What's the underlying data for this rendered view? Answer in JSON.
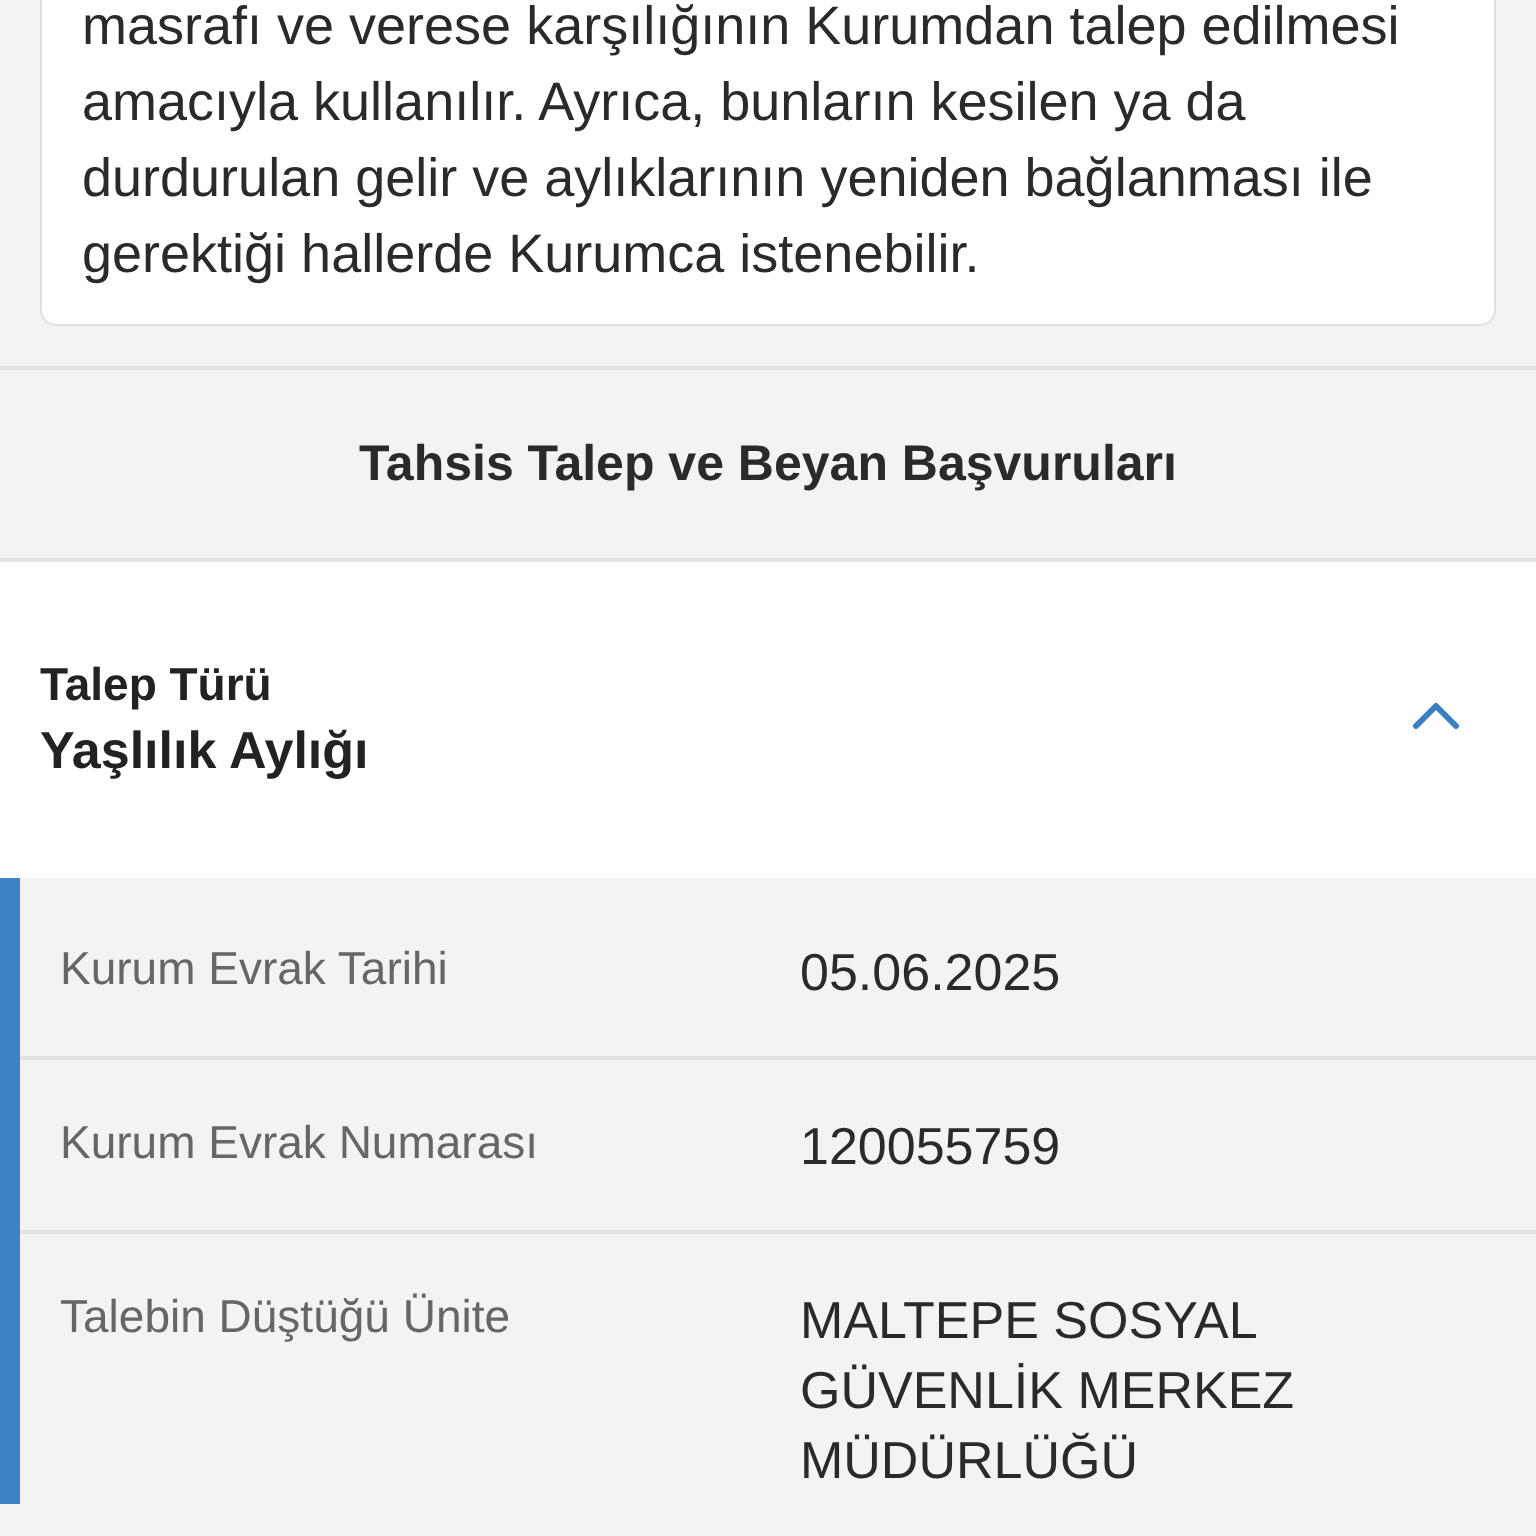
{
  "info_card": {
    "text": "masrafı ve verese karşılığının Kurumdan talep edilmesi amacıyla kullanılır. Ayrıca, bunların kesilen ya da durdurulan gelir ve aylıklarının yeniden bağlanması ile gerektiği hallerde Kurumca istenebilir."
  },
  "section_title": "Tahsis Talep ve Beyan Başvuruları",
  "request": {
    "label": "Talep Türü",
    "value": "Yaşlılık Aylığı",
    "expanded": true,
    "details": [
      {
        "label": "Kurum Evrak Tarihi",
        "value": "05.06.2025"
      },
      {
        "label": "Kurum Evrak Numarası",
        "value": "120055759"
      },
      {
        "label": "Talebin Düştüğü Ünite",
        "value": "MALTEPE SOSYAL GÜVENLİK MERKEZ MÜDÜRLÜĞÜ"
      }
    ]
  }
}
